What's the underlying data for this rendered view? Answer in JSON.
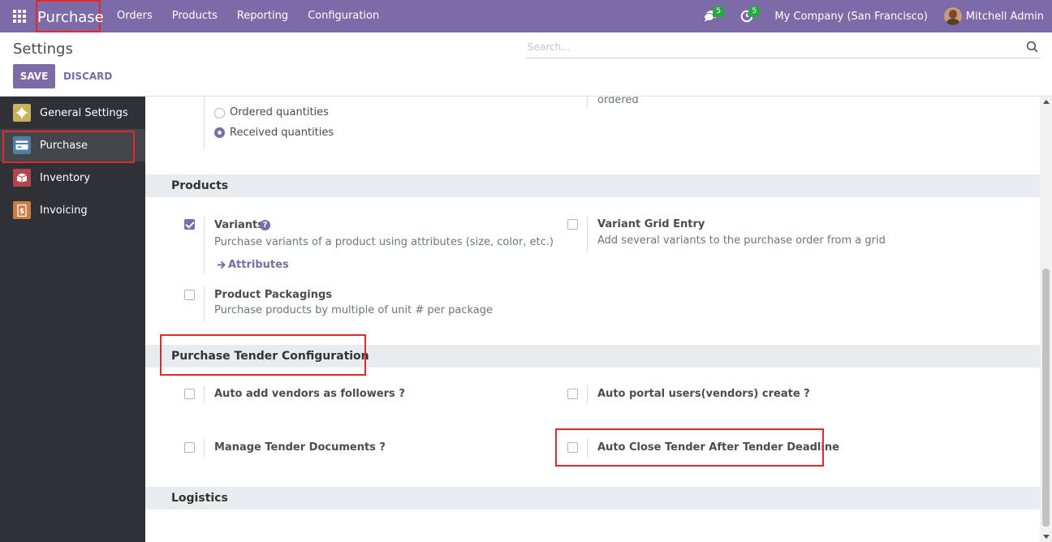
{
  "navbar": {
    "brand": "Purchase",
    "menu": [
      "Orders",
      "Products",
      "Reporting",
      "Configuration"
    ],
    "messages_count": "5",
    "activities_count": "5",
    "company": "My Company (San Francisco)",
    "user": "Mitchell Admin"
  },
  "control_panel": {
    "title": "Settings",
    "search_placeholder": "Search...",
    "save_label": "SAVE",
    "discard_label": "DISCARD"
  },
  "sidebar": {
    "items": [
      {
        "label": "General Settings",
        "icon": "gear-icon"
      },
      {
        "label": "Purchase",
        "icon": "purchase-card-icon",
        "active": true
      },
      {
        "label": "Inventory",
        "icon": "box-icon"
      },
      {
        "label": "Invoicing",
        "icon": "invoice-icon"
      }
    ]
  },
  "content": {
    "bill_control": {
      "options": [
        "Ordered quantities",
        "Received quantities"
      ],
      "selected": "Received quantities",
      "right_partial_text": "ordered"
    },
    "products": {
      "title": "Products",
      "variants": {
        "label": "Variants",
        "desc": "Purchase variants of a product using attributes (size, color, etc.)",
        "link": "Attributes",
        "checked": true
      },
      "variant_grid": {
        "label": "Variant Grid Entry",
        "desc": "Add several variants to the purchase order from a grid",
        "checked": false
      },
      "packagings": {
        "label": "Product Packagings",
        "desc": "Purchase products by multiple of unit # per package",
        "checked": false
      }
    },
    "tender": {
      "title": "Purchase Tender Configuration",
      "auto_add_vendors": {
        "label": "Auto add vendors as followers ?",
        "checked": false
      },
      "auto_portal_users": {
        "label": "Auto portal users(vendors) create ?",
        "checked": false
      },
      "manage_documents": {
        "label": "Manage Tender Documents ?",
        "checked": false
      },
      "auto_close": {
        "label": "Auto Close Tender After Tender Deadline",
        "checked": false
      }
    },
    "logistics": {
      "title": "Logistics"
    }
  },
  "colors": {
    "navbar": "#7c6ba6",
    "sidebar": "#2f3136",
    "sidebar_active": "#43454a",
    "primary": "#7c6ba6",
    "section_bg": "#e9ecef",
    "highlight": "#e0292b"
  }
}
